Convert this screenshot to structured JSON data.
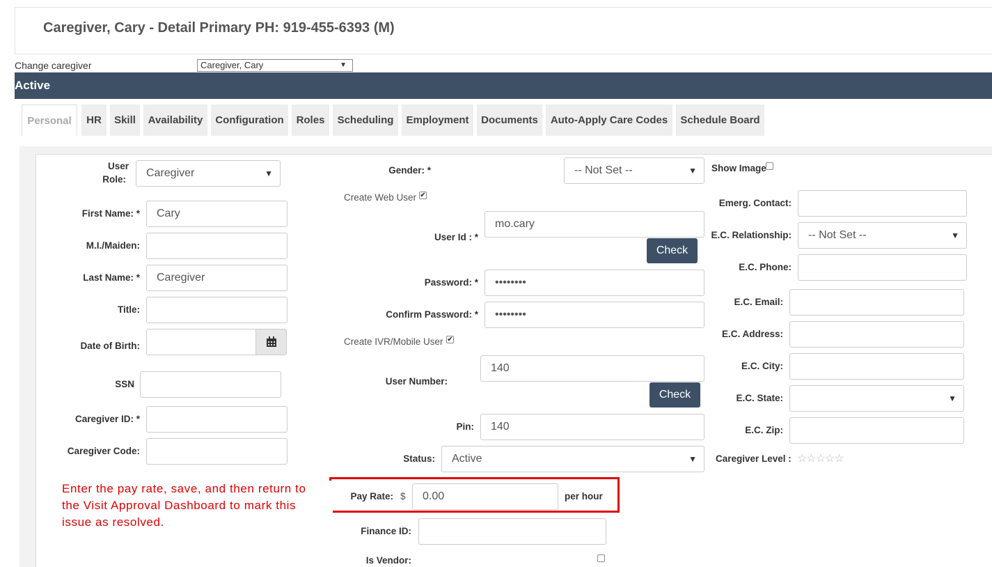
{
  "header": {
    "title": "Caregiver, Cary - Detail Primary PH: 919-455-6393 (M)"
  },
  "change_caregiver": {
    "label": "Change caregiver",
    "value": "Caregiver, Cary"
  },
  "status_bar": {
    "text": "Active"
  },
  "tabs": [
    {
      "label": "Personal"
    },
    {
      "label": "HR"
    },
    {
      "label": "Skill"
    },
    {
      "label": "Availability"
    },
    {
      "label": "Configuration"
    },
    {
      "label": "Roles"
    },
    {
      "label": "Scheduling"
    },
    {
      "label": "Employment"
    },
    {
      "label": "Documents"
    },
    {
      "label": "Auto-Apply Care Codes"
    },
    {
      "label": "Schedule Board"
    }
  ],
  "left": {
    "user_role_label_1": "User",
    "user_role_label_2": "Role:",
    "user_role_value": "Caregiver",
    "first_name_label": "First Name: *",
    "first_name_value": "Cary",
    "mi_label": "M.I./Maiden:",
    "mi_value": "",
    "last_name_label": "Last Name: *",
    "last_name_value": "Caregiver",
    "title_label": "Title:",
    "title_value": "",
    "dob_label": "Date of Birth:",
    "dob_value": "",
    "ssn_label": "SSN",
    "ssn_value": "",
    "caregiver_id_label": "Caregiver ID: *",
    "caregiver_id_value": "",
    "caregiver_code_label": "Caregiver Code:",
    "caregiver_code_value": ""
  },
  "middle": {
    "gender_label": "Gender: *",
    "gender_value": "-- Not Set --",
    "create_web_user_label": "Create Web User",
    "user_id_label": "User Id : *",
    "user_id_value": "mo.cary",
    "check_label": "Check",
    "password_label": "Password: *",
    "password_value": "••••••••",
    "confirm_password_label": "Confirm Password: *",
    "confirm_password_value": "••••••••",
    "create_ivr_label": "Create IVR/Mobile User",
    "user_number_label": "User Number:",
    "user_number_value": "140",
    "check2_label": "Check",
    "pin_label": "Pin:",
    "pin_value": "140",
    "status_label": "Status:",
    "status_value": "Active",
    "pay_rate_label": "Pay Rate:",
    "pay_rate_currency": "$",
    "pay_rate_value": "0.00",
    "pay_rate_unit": "per hour",
    "finance_id_label": "Finance ID:",
    "finance_id_value": "",
    "is_vendor_label": "Is Vendor:"
  },
  "right": {
    "show_image_label": "Show Image",
    "emerg_contact_label": "Emerg. Contact:",
    "ec_relationship_label": "E.C. Relationship:",
    "ec_relationship_value": "-- Not Set --",
    "ec_phone_label": "E.C. Phone:",
    "ec_email_label": "E.C. Email:",
    "ec_address_label": "E.C. Address:",
    "ec_city_label": "E.C. City:",
    "ec_state_label": "E.C. State:",
    "ec_state_value": "",
    "ec_zip_label": "E.C. Zip:",
    "caregiver_level_label": "Caregiver Level :",
    "caregiver_level_stars": "☆☆☆☆☆"
  },
  "annotation": {
    "note": "Enter the pay rate, save, and then return to the Visit Approval Dashboard to mark this issue as resolved."
  },
  "icons": {
    "calendar": "calendar-icon",
    "dropdown": "chevron-down-icon",
    "stars": "star-icon"
  },
  "colors": {
    "header_bar": "#3d5066",
    "annotation": "#e0000a"
  }
}
